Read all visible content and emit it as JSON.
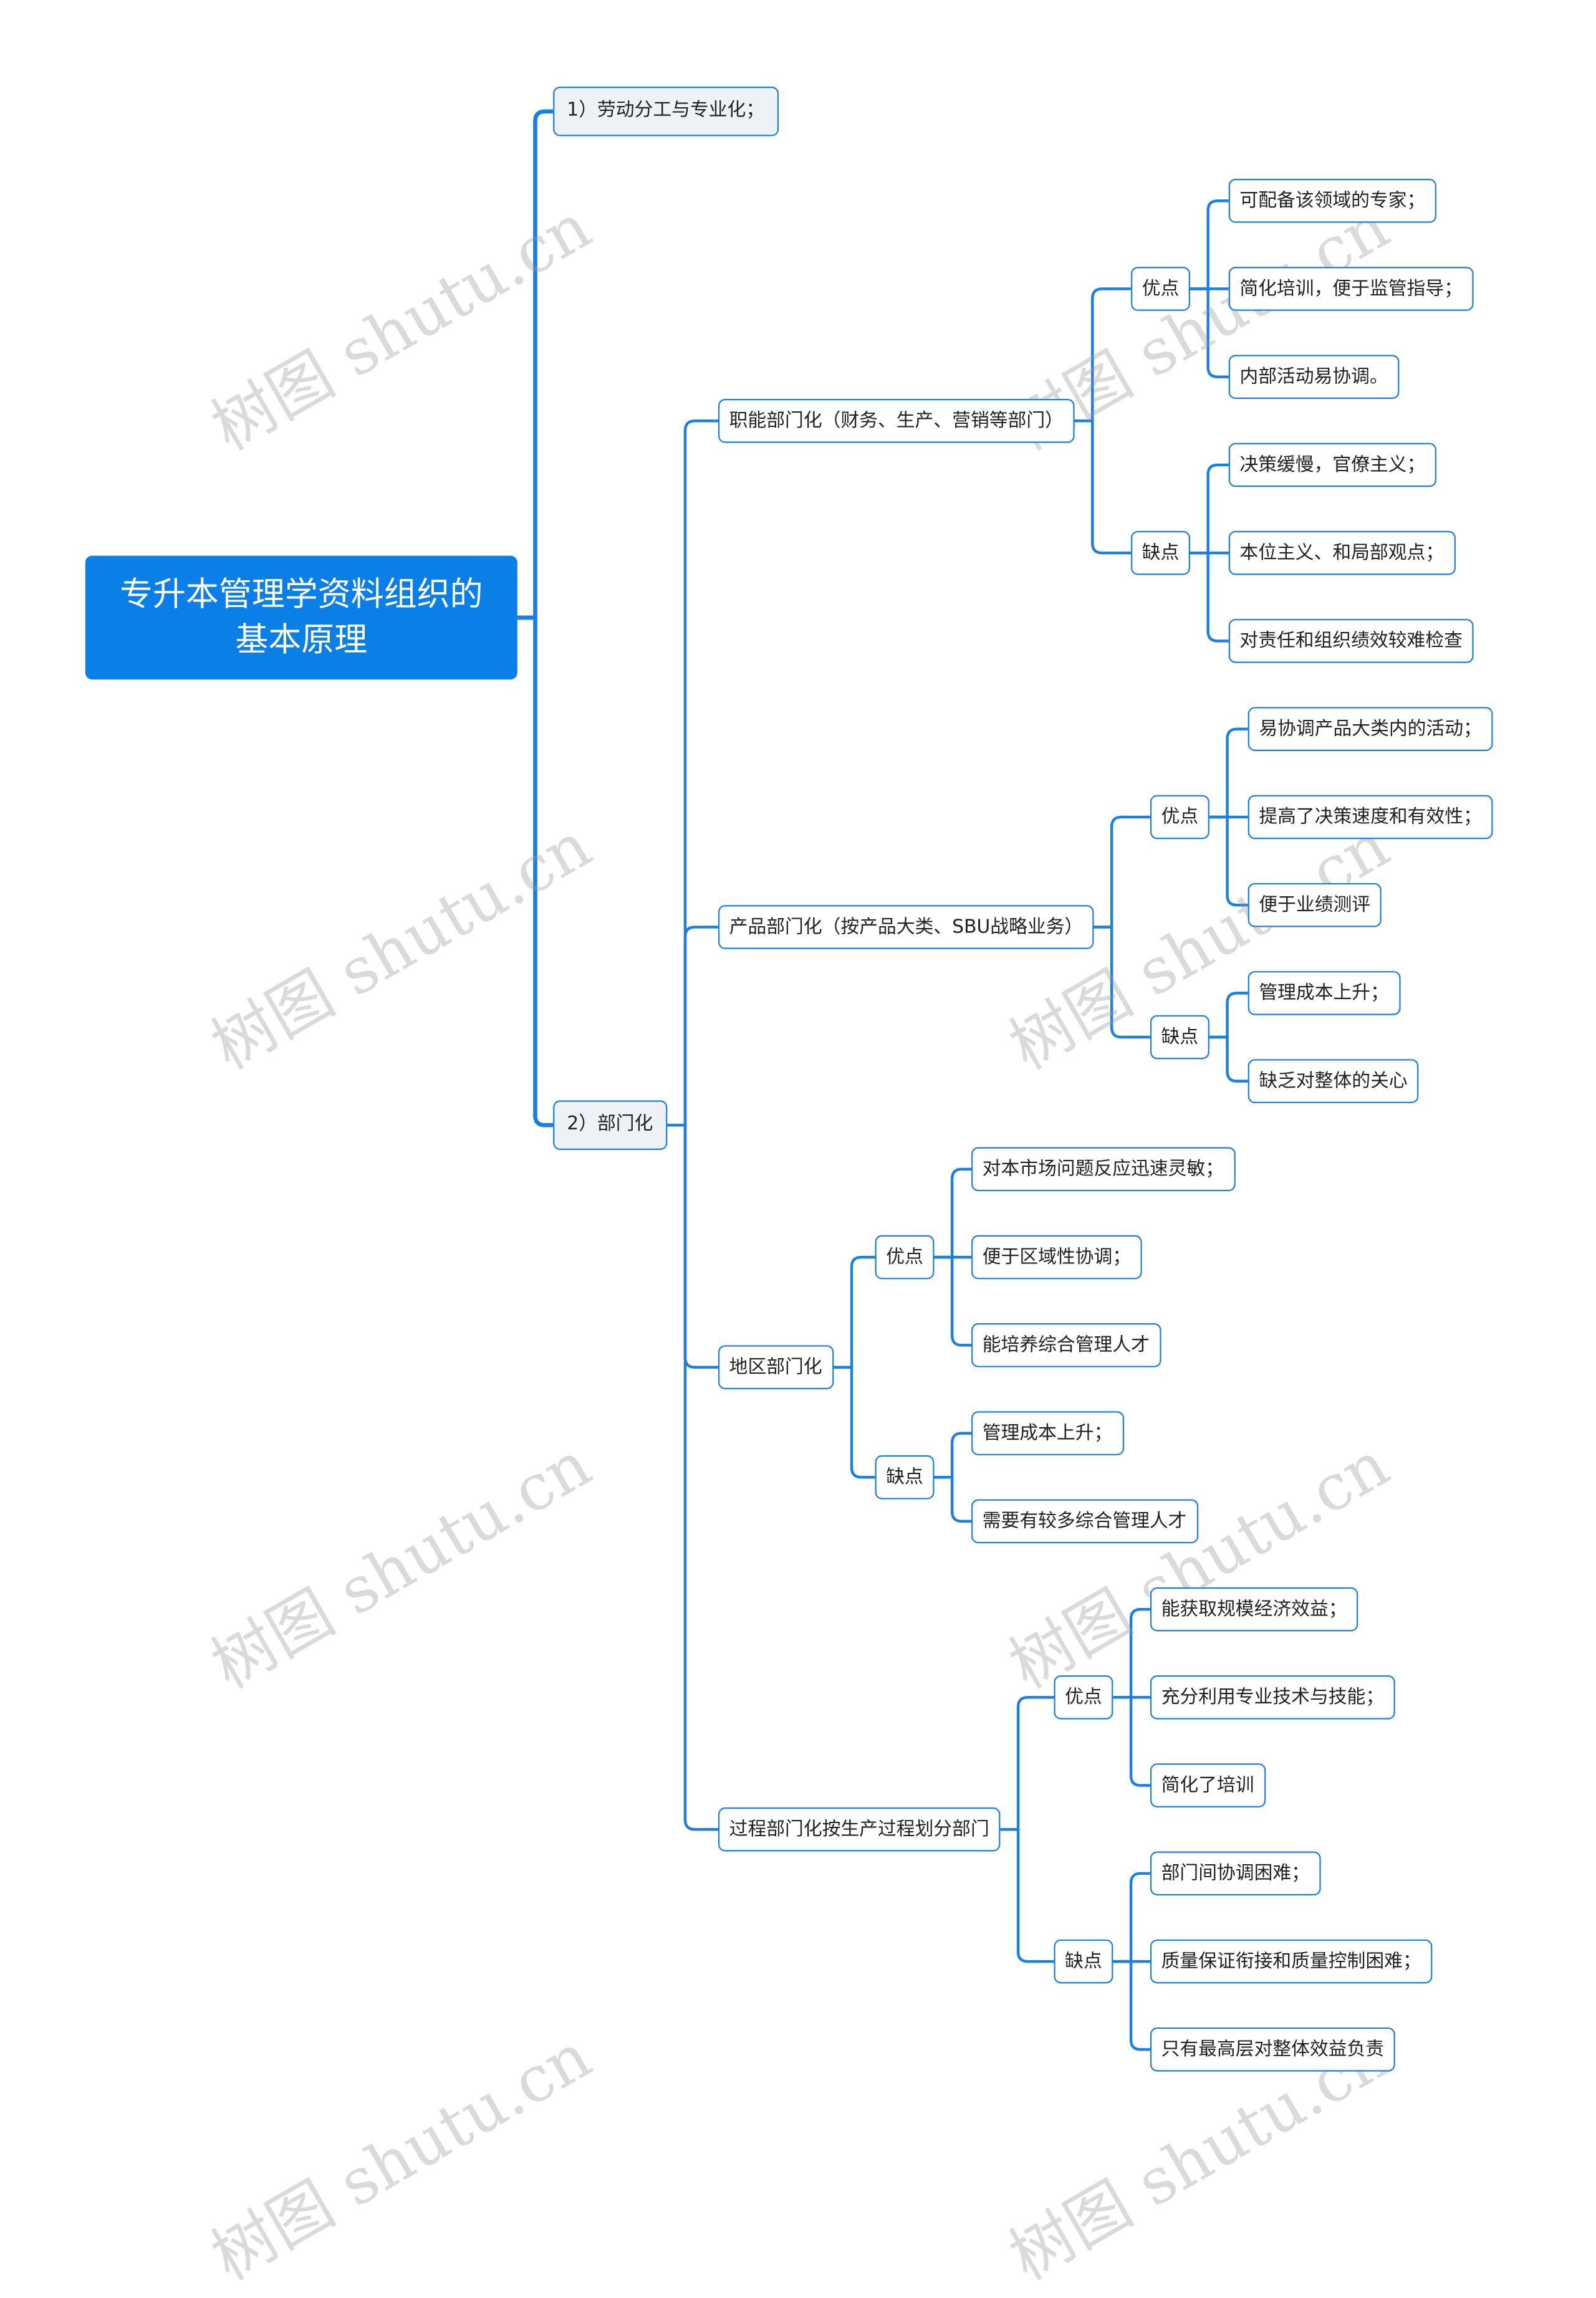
{
  "root": {
    "title": "专升本管理学资料组织的基本原理",
    "children": [
      {
        "label": "1）劳动分工与专业化；"
      },
      {
        "label": "2）部门化",
        "children": [
          {
            "label": "职能部门化（财务、生产、营销等部门）",
            "children": [
              {
                "label": "优点",
                "children": [
                  {
                    "label": "可配备该领域的专家；"
                  },
                  {
                    "label": "简化培训，便于监管指导；"
                  },
                  {
                    "label": "内部活动易协调。"
                  }
                ]
              },
              {
                "label": "缺点",
                "children": [
                  {
                    "label": "决策缓慢，官僚主义；"
                  },
                  {
                    "label": "本位主义、和局部观点；"
                  },
                  {
                    "label": "对责任和组织绩效较难检查"
                  }
                ]
              }
            ]
          },
          {
            "label": "产品部门化（按产品大类、SBU战略业务）",
            "children": [
              {
                "label": "优点",
                "children": [
                  {
                    "label": "易协调产品大类内的活动；"
                  },
                  {
                    "label": "提高了决策速度和有效性；"
                  },
                  {
                    "label": "便于业绩测评"
                  }
                ]
              },
              {
                "label": "缺点",
                "children": [
                  {
                    "label": "管理成本上升；"
                  },
                  {
                    "label": "缺乏对整体的关心"
                  }
                ]
              }
            ]
          },
          {
            "label": "地区部门化",
            "children": [
              {
                "label": "优点",
                "children": [
                  {
                    "label": "对本市场问题反应迅速灵敏；"
                  },
                  {
                    "label": "便于区域性协调；"
                  },
                  {
                    "label": "能培养综合管理人才"
                  }
                ]
              },
              {
                "label": "缺点",
                "children": [
                  {
                    "label": "管理成本上升；"
                  },
                  {
                    "label": "需要有较多综合管理人才"
                  }
                ]
              }
            ]
          },
          {
            "label": "过程部门化按生产过程划分部门",
            "children": [
              {
                "label": "优点",
                "children": [
                  {
                    "label": "能获取规模经济效益；"
                  },
                  {
                    "label": "充分利用专业技术与技能；"
                  },
                  {
                    "label": "简化了培训"
                  }
                ]
              },
              {
                "label": "缺点",
                "children": [
                  {
                    "label": "部门间协调困难；"
                  },
                  {
                    "label": "质量保证衔接和质量控制困难；"
                  },
                  {
                    "label": "只有最高层对整体效益负责"
                  }
                ]
              }
            ]
          }
        ]
      }
    ]
  },
  "watermark": "树图 shutu.cn",
  "colors": {
    "root": "#0a7fe8",
    "line": "#1a7fe0",
    "level1_fill": "#eef2f7"
  }
}
